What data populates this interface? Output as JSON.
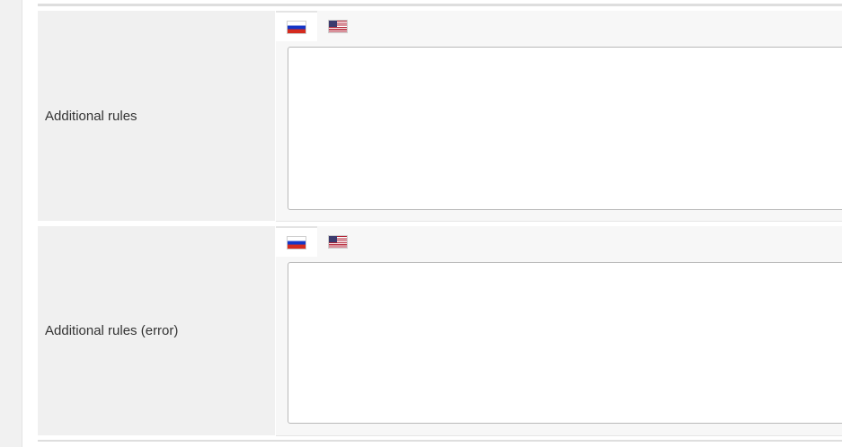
{
  "fields": [
    {
      "label": "Additional rules",
      "active_language": "Russian",
      "languages": [
        {
          "name": "Russian",
          "icon": "russia-flag-icon"
        },
        {
          "name": "English",
          "icon": "usa-flag-icon"
        }
      ],
      "value": ""
    },
    {
      "label": "Additional rules (error)",
      "active_language": "Russian",
      "languages": [
        {
          "name": "Russian",
          "icon": "russia-flag-icon"
        },
        {
          "name": "English",
          "icon": "usa-flag-icon"
        }
      ],
      "value": ""
    }
  ],
  "colors": {
    "label_background": "#f0f0f0",
    "field_background": "#f7f7f7",
    "editor_border": "#b9b9b9"
  }
}
